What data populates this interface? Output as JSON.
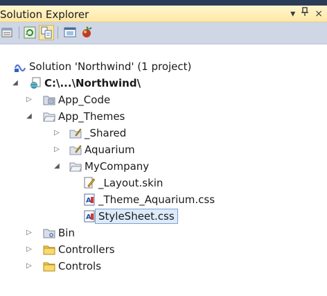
{
  "window": {
    "title": "Solution Explorer",
    "pin_glyph": "▾",
    "autohide_glyph": "ᵖ",
    "close_glyph": "×"
  },
  "toolbar": {
    "buttons": [
      {
        "icon": "properties-icon"
      },
      {
        "icon": "refresh-icon"
      },
      {
        "icon": "show-all-files-icon"
      },
      {
        "icon": "view-designer-icon"
      },
      {
        "icon": "copy-website-icon"
      }
    ]
  },
  "tree": {
    "nodes": [
      {
        "label": "Solution 'Northwind' (1 project)",
        "icon": "solution-icon",
        "expand": "none",
        "level": 0
      },
      {
        "label": "C:\\...\\Northwind\\",
        "icon": "website-project-icon",
        "expand": "expanded",
        "level": 0,
        "bold": true
      },
      {
        "label": "App_Code",
        "icon": "app-code-folder-icon",
        "expand": "collapsed",
        "level": 1
      },
      {
        "label": "App_Themes",
        "icon": "themes-folder-icon",
        "expand": "expanded",
        "level": 1
      },
      {
        "label": "_Shared",
        "icon": "theme-folder-icon",
        "expand": "collapsed",
        "level": 2
      },
      {
        "label": "Aquarium",
        "icon": "theme-folder-icon",
        "expand": "collapsed",
        "level": 2
      },
      {
        "label": "MyCompany",
        "icon": "theme-folder-open-icon",
        "expand": "expanded",
        "level": 2
      },
      {
        "label": "_Layout.skin",
        "icon": "skin-file-icon",
        "expand": "none",
        "level": 3
      },
      {
        "label": "_Theme_Aquarium.css",
        "icon": "css-file-icon",
        "expand": "none",
        "level": 3
      },
      {
        "label": "StyleSheet.css",
        "icon": "css-file-icon",
        "expand": "none",
        "level": 3,
        "selected": true
      },
      {
        "label": "Bin",
        "icon": "bin-folder-icon",
        "expand": "collapsed",
        "level": 1
      },
      {
        "label": "Controllers",
        "icon": "folder-icon",
        "expand": "collapsed",
        "level": 1
      },
      {
        "label": "Controls",
        "icon": "folder-icon",
        "expand": "collapsed",
        "level": 1
      }
    ]
  }
}
